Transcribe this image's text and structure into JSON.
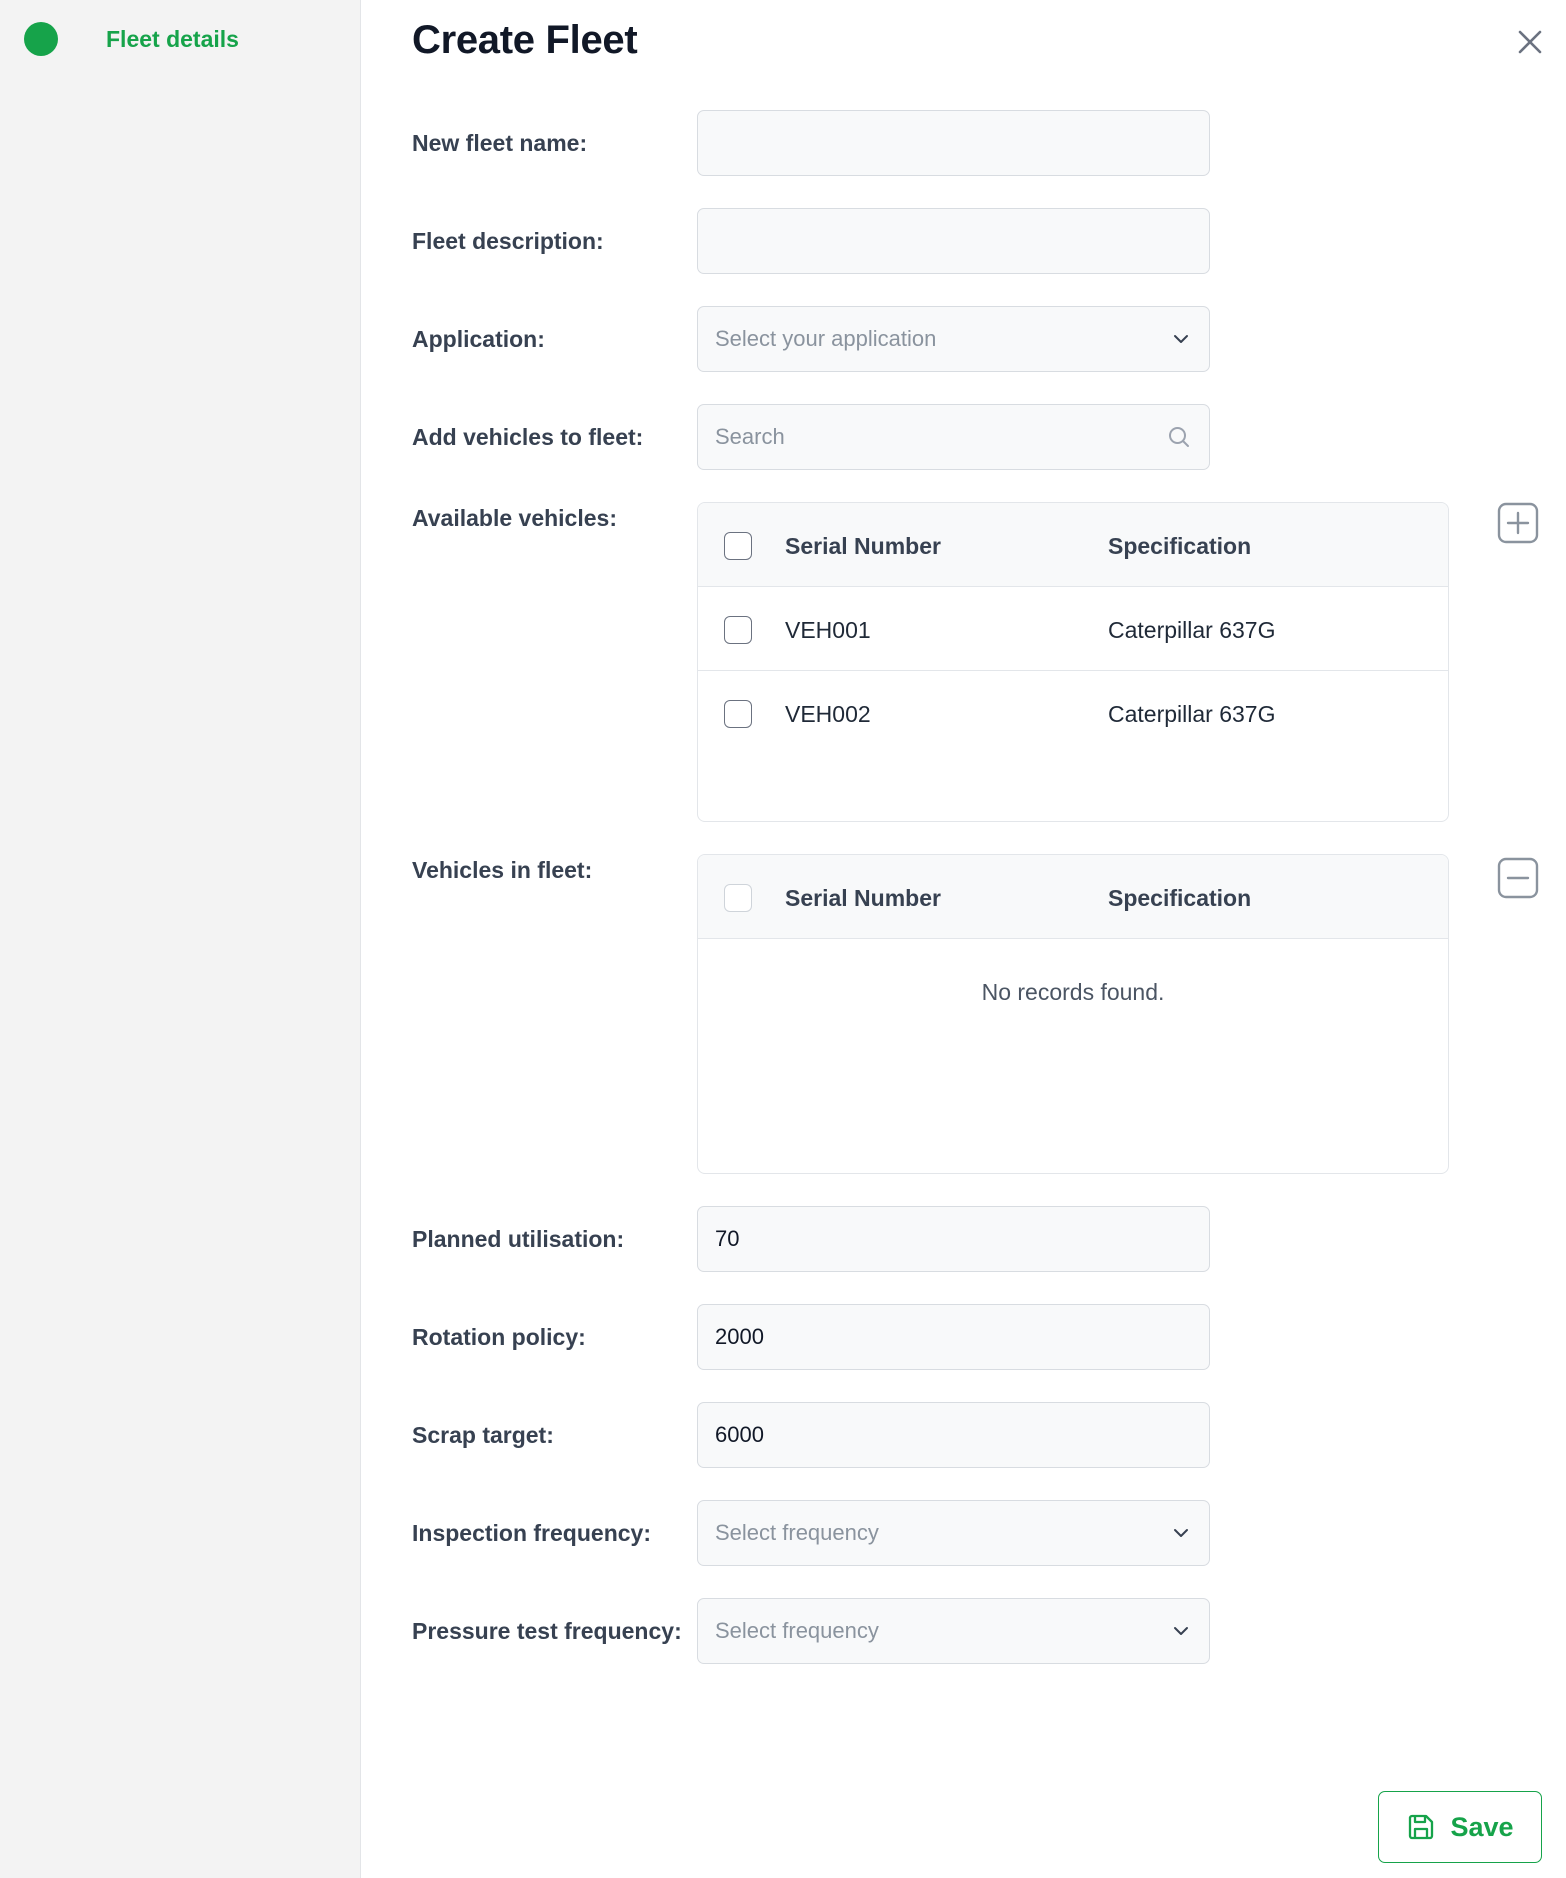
{
  "sidebar": {
    "steps": [
      {
        "label": "Fleet details",
        "status_color": "#16a34a"
      }
    ]
  },
  "header": {
    "title": "Create Fleet",
    "close_icon": "close-icon"
  },
  "form": {
    "fleet_name": {
      "label": "New fleet name:",
      "value": ""
    },
    "fleet_description": {
      "label": "Fleet description:",
      "value": ""
    },
    "application": {
      "label": "Application:",
      "placeholder": "Select your application",
      "icon": "chevron-down-icon"
    },
    "add_vehicles": {
      "label": "Add vehicles to fleet:",
      "placeholder": "Search",
      "icon": "search-icon"
    },
    "available_vehicles": {
      "label": "Available vehicles:",
      "columns": [
        "Serial Number",
        "Specification"
      ],
      "rows": [
        {
          "serial": "VEH001",
          "spec": "Caterpillar 637G"
        },
        {
          "serial": "VEH002",
          "spec": "Caterpillar 637G"
        }
      ],
      "action_icon": "plus-square-icon"
    },
    "vehicles_in_fleet": {
      "label": "Vehicles in fleet:",
      "columns": [
        "Serial Number",
        "Specification"
      ],
      "rows": [],
      "empty_text": "No records found.",
      "action_icon": "minus-square-icon"
    },
    "planned_utilisation": {
      "label": "Planned utilisation:",
      "value": "70"
    },
    "rotation_policy": {
      "label": "Rotation policy:",
      "value": "2000"
    },
    "scrap_target": {
      "label": "Scrap target:",
      "value": "6000"
    },
    "inspection_frequency": {
      "label": "Inspection frequency:",
      "placeholder": "Select frequency",
      "icon": "chevron-down-icon"
    },
    "pressure_test_frequency": {
      "label": "Pressure test frequency:",
      "placeholder": "Select frequency",
      "icon": "chevron-down-icon"
    }
  },
  "footer": {
    "save_label": "Save",
    "save_icon": "floppy-disk-icon"
  },
  "colors": {
    "accent": "#16a34a",
    "sidebar_bg": "#f3f3f3",
    "input_bg": "#f8f9fa",
    "border": "#d8dce1"
  }
}
